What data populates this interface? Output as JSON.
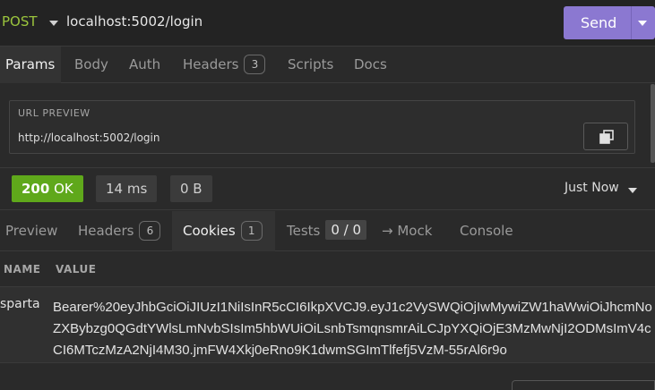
{
  "request": {
    "method": "POST",
    "url": "localhost:5002/login",
    "send_label": "Send"
  },
  "request_tabs": [
    {
      "label": "Params"
    },
    {
      "label": "Body"
    },
    {
      "label": "Auth"
    },
    {
      "label": "Headers",
      "count": "3"
    },
    {
      "label": "Scripts"
    },
    {
      "label": "Docs"
    }
  ],
  "url_preview": {
    "title": "URL PREVIEW",
    "url": "http://localhost:5002/login"
  },
  "status": {
    "code": "200",
    "text": "OK",
    "time": "14 ms",
    "size": "0 B",
    "when": "Just Now"
  },
  "response_tabs": [
    {
      "label": "Preview"
    },
    {
      "label": "Headers",
      "count": "6"
    },
    {
      "label": "Cookies",
      "count": "1"
    },
    {
      "label": "Tests",
      "count": "0 / 0"
    },
    {
      "label": "→ Mock"
    },
    {
      "label": "Console"
    }
  ],
  "cookies": {
    "columns": [
      "NAME",
      "VALUE"
    ],
    "rows": [
      {
        "name": "sparta",
        "value": "Bearer%20eyJhbGciOiJIUzI1NiIsInR5cCI6IkpXVCJ9.eyJ1c2VySWQiOjIwMywiZW1haWwiOiJhcmNoZXBybzg0QGdtYWlsLmNvbSIsIm5hbWUiOiLsnbTsmqnsmrAiLCJpYXQiOjE3MzMwNjI2ODMsImV4cCI6MTczMzA2NjI4M30.jmFW4Xkj0eRno9K1dwmSGImTlfefj5VzM-55rAl6r9o"
      }
    ]
  },
  "colors": {
    "accent": "#8b78d1",
    "method": "#9bc53d",
    "status_ok": "#5fa81b"
  }
}
